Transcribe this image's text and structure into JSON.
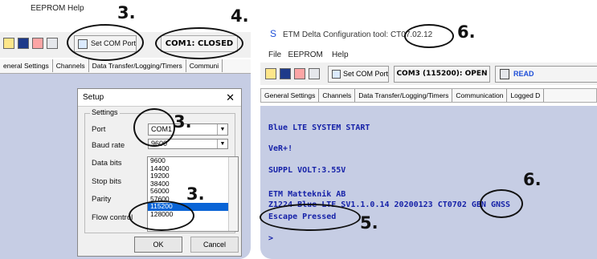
{
  "left": {
    "menu": [
      "EEPROM",
      "Help"
    ],
    "set_com_label": "Set COM Port",
    "status": "COM1: CLOSED",
    "tabs": [
      "eneral Settings",
      "Channels",
      "Data Transfer/Logging/Timers",
      "Communi"
    ],
    "dialog": {
      "title": "Setup",
      "group_label": "Settings",
      "fields": {
        "port": {
          "label": "Port",
          "value": "COM1"
        },
        "baud": {
          "label": "Baud rate",
          "value": "9600"
        },
        "data_bits": {
          "label": "Data bits"
        },
        "stop_bits": {
          "label": "Stop bits"
        },
        "parity": {
          "label": "Parity"
        },
        "flow": {
          "label": "Flow control"
        }
      },
      "baud_list": [
        "9600",
        "14400",
        "19200",
        "38400",
        "56000",
        "57600",
        "115200",
        "128000"
      ],
      "selected_baud": "115200",
      "ok": "OK",
      "cancel": "Cancel"
    }
  },
  "right": {
    "title_prefix": "ETM Delta Configuration tool: ",
    "title_version": "CT07.02.12",
    "menu": [
      "File",
      "EEPROM",
      "Help"
    ],
    "set_com_label": "Set COM Port",
    "status": "COM3 (115200): OPEN",
    "read_label": "READ",
    "tabs": [
      "General Settings",
      "Channels",
      "Data Transfer/Logging/Timers",
      "Communication",
      "Logged D"
    ],
    "terminal": [
      "Blue LTE SYSTEM START",
      "VeR+!",
      "SUPPL VOLT:3.55V",
      "ETM Matteknik AB",
      "Z1224 Blue LTE SV1.1.0.14 20200123 CT0702 GEN GNSS",
      "Escape Pressed",
      ">"
    ]
  },
  "annotations": {
    "n3a": "3.",
    "n3b": "3.",
    "n3c": "3.",
    "n4": "4.",
    "n6a": "6.",
    "n6b": "6.",
    "n5": "5."
  }
}
